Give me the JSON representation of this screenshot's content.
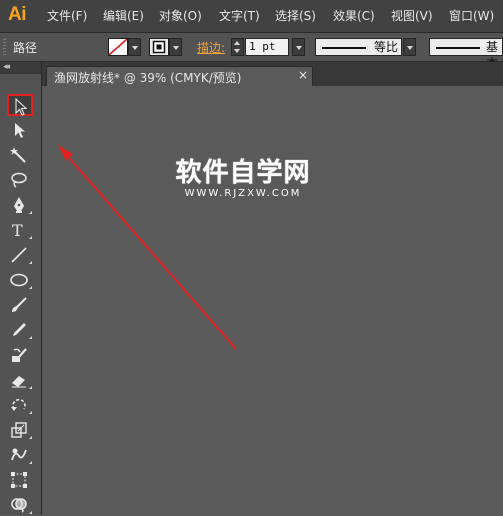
{
  "app": {
    "logo": "Ai"
  },
  "menu": {
    "file": "文件(F)",
    "edit": "编辑(E)",
    "object": "对象(O)",
    "type": "文字(T)",
    "select": "选择(S)",
    "effect": "效果(C)",
    "view": "视图(V)",
    "window": "窗口(W)"
  },
  "control": {
    "selection_type": "路径",
    "stroke_label": "描边:",
    "stroke_weight": "1 pt",
    "variable_width": "等比",
    "brush_definition": "基本"
  },
  "document": {
    "tab_title": "渔网放射线* @ 39% (CMYK/预览)",
    "close_glyph": "×"
  },
  "watermark": {
    "title": "软件自学网",
    "url": "WWW.RJZXW.COM"
  },
  "tools": [
    {
      "name": "selection-tool",
      "icon": "selection-icon",
      "selected": true
    },
    {
      "name": "direct-selection-tool",
      "icon": "direct-selection-icon"
    },
    {
      "name": "magic-wand-tool",
      "icon": "magic-wand-icon"
    },
    {
      "name": "lasso-tool",
      "icon": "lasso-icon"
    },
    {
      "name": "pen-tool",
      "icon": "pen-icon"
    },
    {
      "name": "type-tool",
      "icon": "type-icon"
    },
    {
      "name": "line-segment-tool",
      "icon": "line-icon"
    },
    {
      "name": "ellipse-tool",
      "icon": "ellipse-icon"
    },
    {
      "name": "paintbrush-tool",
      "icon": "paintbrush-icon"
    },
    {
      "name": "pencil-tool",
      "icon": "pencil-icon"
    },
    {
      "name": "blob-brush-tool",
      "icon": "blob-brush-icon"
    },
    {
      "name": "eraser-tool",
      "icon": "eraser-icon"
    },
    {
      "name": "rotate-tool",
      "icon": "rotate-icon"
    },
    {
      "name": "scale-tool",
      "icon": "scale-icon"
    },
    {
      "name": "warp-tool",
      "icon": "warp-icon"
    },
    {
      "name": "free-transform-tool",
      "icon": "free-transform-icon"
    },
    {
      "name": "shape-builder-tool",
      "icon": "shape-builder-icon"
    }
  ],
  "colors": {
    "accent": "#f7a41d",
    "stroke_label": "#f2a23b",
    "selection_highlight": "#e0211d",
    "annotation_arrow": "#e0211d",
    "canvas": "#5a5a5a"
  }
}
